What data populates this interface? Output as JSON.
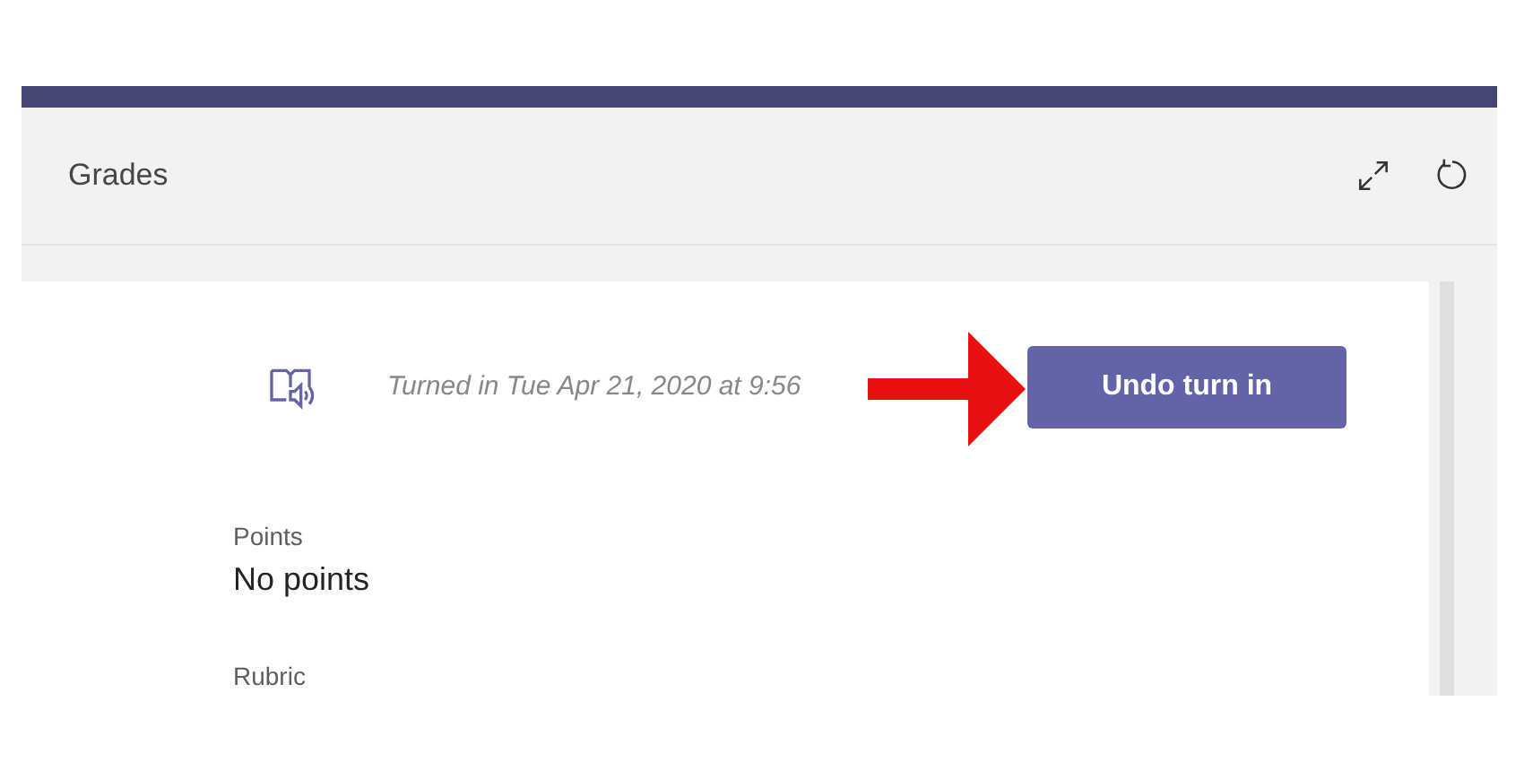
{
  "header": {
    "title": "Grades"
  },
  "submission": {
    "status": "Turned in Tue Apr 21, 2020 at 9:56",
    "button": "Undo turn in"
  },
  "fields": [
    {
      "label": "Points",
      "value": "No points"
    },
    {
      "label": "Rubric"
    }
  ]
}
